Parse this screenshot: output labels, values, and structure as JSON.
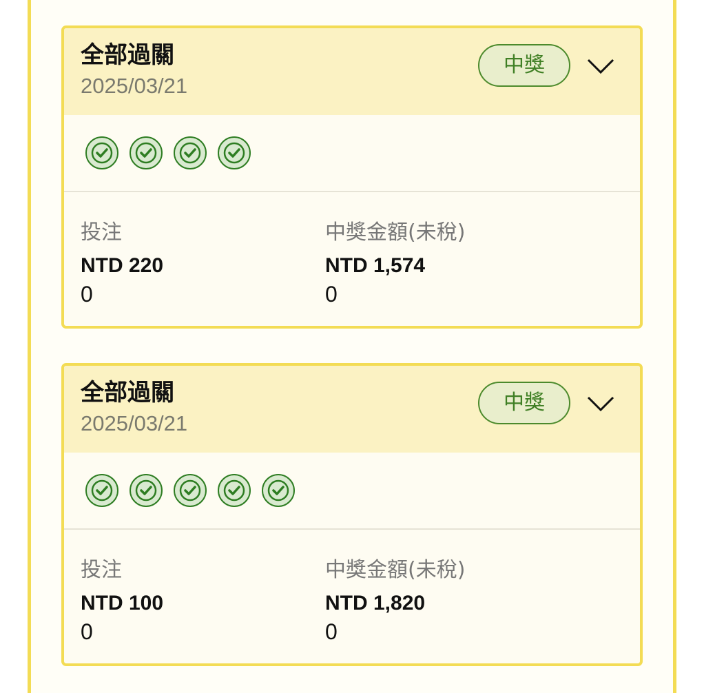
{
  "colors": {
    "frame_border": "#f3dc55",
    "card_header_bg": "#fbf2c3",
    "badge_border": "#4c8a2c",
    "badge_text": "#3f7f24",
    "check_fill": "#d9ead0",
    "check_stroke": "#2e7d22"
  },
  "cards": [
    {
      "title": "全部過關",
      "date": "2025/03/21",
      "status_badge": "中獎",
      "check_icon_count": 4,
      "stake_label": "投注",
      "stake_amount": "NTD 220",
      "stake_sub": "0",
      "prize_label": "中獎金額(未稅)",
      "prize_amount": "NTD 1,574",
      "prize_sub": "0"
    },
    {
      "title": "全部過關",
      "date": "2025/03/21",
      "status_badge": "中獎",
      "check_icon_count": 5,
      "stake_label": "投注",
      "stake_amount": "NTD 100",
      "stake_sub": "0",
      "prize_label": "中獎金額(未稅)",
      "prize_amount": "NTD 1,820",
      "prize_sub": "0"
    }
  ],
  "icons": {
    "expand": "chevron-down-icon",
    "leg_result": "check-circle-icon"
  }
}
